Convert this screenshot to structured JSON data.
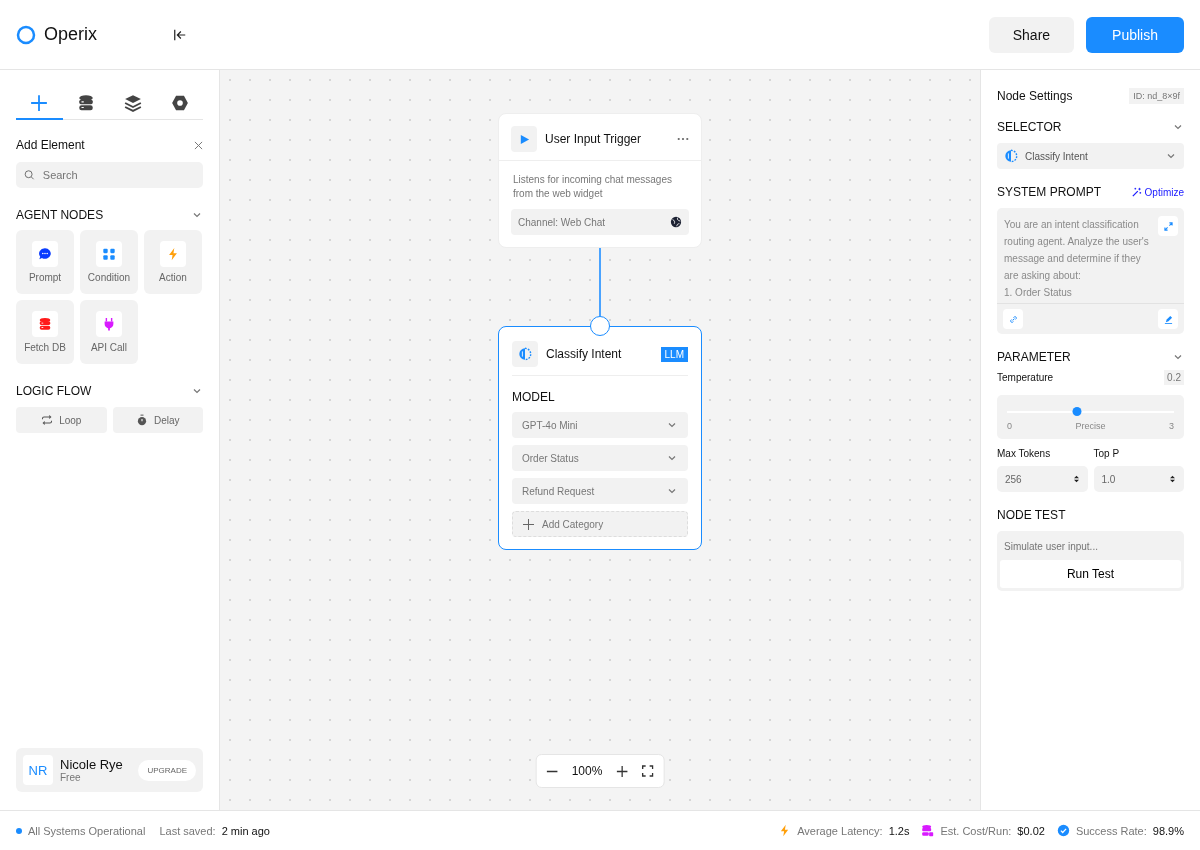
{
  "header": {
    "logo": "Operix",
    "buttons": [
      {
        "label": "Share",
        "kind": "secondary"
      },
      {
        "label": "Publish",
        "kind": "primary"
      }
    ]
  },
  "sidebar": {
    "tabs": [
      {
        "kind": "add",
        "selected": true
      },
      {
        "kind": "database",
        "selected": false
      },
      {
        "kind": "layers",
        "selected": false
      },
      {
        "kind": "settings",
        "selected": false
      }
    ],
    "title": "Add Element",
    "search": {
      "placeholder": "Search"
    },
    "agent_nodes": {
      "title": "AGENT NODES",
      "expanded": true,
      "items": [
        {
          "label": "Prompt",
          "kind": "chat",
          "color": "#0a3cff"
        },
        {
          "label": "Condition",
          "kind": "branch",
          "color": "#1a8cff"
        },
        {
          "label": "Action",
          "kind": "bolt",
          "color": "#ff9f0a"
        },
        {
          "label": "Fetch DB",
          "kind": "database",
          "color": "#ff1a1a"
        },
        {
          "label": "API Call",
          "kind": "plug",
          "color": "#d81aff"
        }
      ]
    },
    "logic_flow": {
      "title": "LOGIC FLOW",
      "expanded": true,
      "items": [
        {
          "label": "Loop",
          "kind": "loop"
        },
        {
          "label": "Delay",
          "kind": "timer"
        }
      ]
    },
    "user": {
      "initials": "NR",
      "name": "Nicole Rye",
      "plan": "Free",
      "action": "UPGRADE"
    }
  },
  "canvas": {
    "trigger": {
      "title": "User Input Trigger",
      "description": "Listens for incoming chat messages from the web widget",
      "channel": "Channel: Web Chat"
    },
    "classifier": {
      "title": "Classify Intent",
      "badge": "LLM",
      "selected": true,
      "section": "MODEL",
      "dropdowns": [
        "GPT-4o Mini",
        "Order Status",
        "Refund Request"
      ],
      "add": "Add Category"
    },
    "zoom": "100%"
  },
  "settings": {
    "title": "Node Settings",
    "id": "ID: nd_8×9f",
    "selector": {
      "title": "SELECTOR",
      "value": "Classify Intent"
    },
    "system_prompt": {
      "title": "SYSTEM PROMPT",
      "action": "Optimize",
      "text": "You are an intent classification routing agent. Analyze the user's message and determine if they are asking about:\n1. Order Status"
    },
    "parameter": {
      "title": "PARAMETER",
      "temperature": {
        "label": "Temperature",
        "value": "0.2",
        "level": 0.42,
        "min": "0",
        "mid": "Precise",
        "max": "3"
      },
      "fields": [
        {
          "label": "Max Tokens",
          "value": "256"
        },
        {
          "label": "Top P",
          "value": "1.0"
        }
      ]
    },
    "node_test": {
      "title": "NODE TEST",
      "placeholder": "Simulate user input...",
      "button": "Run Test"
    }
  },
  "status_bar": {
    "status": {
      "label": "All Systems Operational",
      "color": "#1a8cff"
    },
    "saved": {
      "label": "Last saved:",
      "value": "2 min ago"
    },
    "metrics": [
      {
        "kind": "bolt",
        "label": "Average Latency:",
        "value": "1.2s"
      },
      {
        "kind": "cost",
        "label": "Est. Cost/Run:",
        "value": "$0.02"
      },
      {
        "kind": "check",
        "label": "Success Rate:",
        "value": "98.9%"
      }
    ]
  }
}
